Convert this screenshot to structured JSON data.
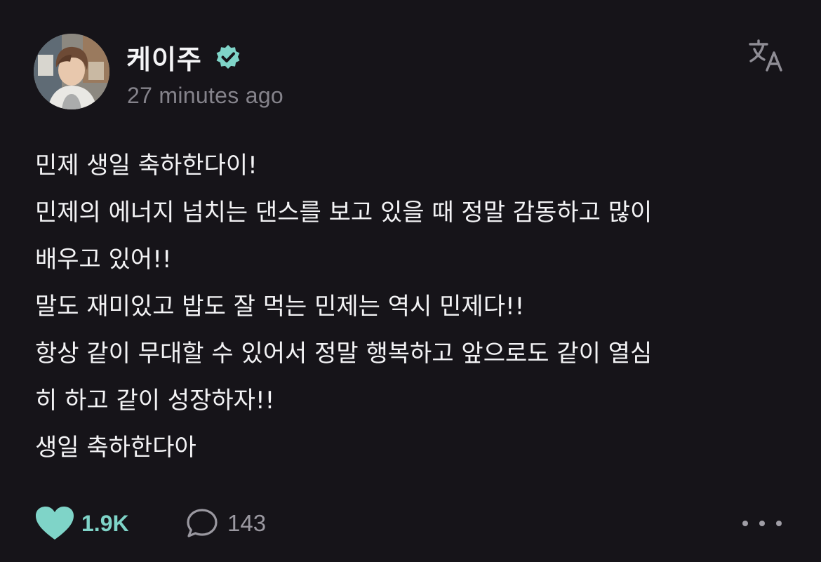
{
  "post": {
    "author": {
      "name": "케이주",
      "verified": true
    },
    "timestamp": "27 minutes ago",
    "lines": [
      "민제 생일 축하한다이!",
      "민제의 에너지 넘치는 댄스를 보고 있을 때 정말 감동하고 많이",
      "배우고 있어!!",
      "말도 재미있고 밥도 잘 먹는 민제는 역시 민제다!!",
      "항상 같이 무대할 수 있어서 정말 행복하고 앞으로도 같이 열심",
      "히 하고 같이 성장하자!!",
      "생일 축하한다아"
    ],
    "stats": {
      "likes": "1.9K",
      "liked": true,
      "comments": "143"
    }
  },
  "icons": {
    "verified": "verified-badge-icon",
    "translate": "translate-icon",
    "like": "heart-icon",
    "comment": "comment-bubble-icon",
    "more": "more-dots-icon"
  },
  "colors": {
    "background": "#161419",
    "accent": "#7fd4c8",
    "secondary_text": "#85838b",
    "primary_text": "#f3f3f5"
  }
}
